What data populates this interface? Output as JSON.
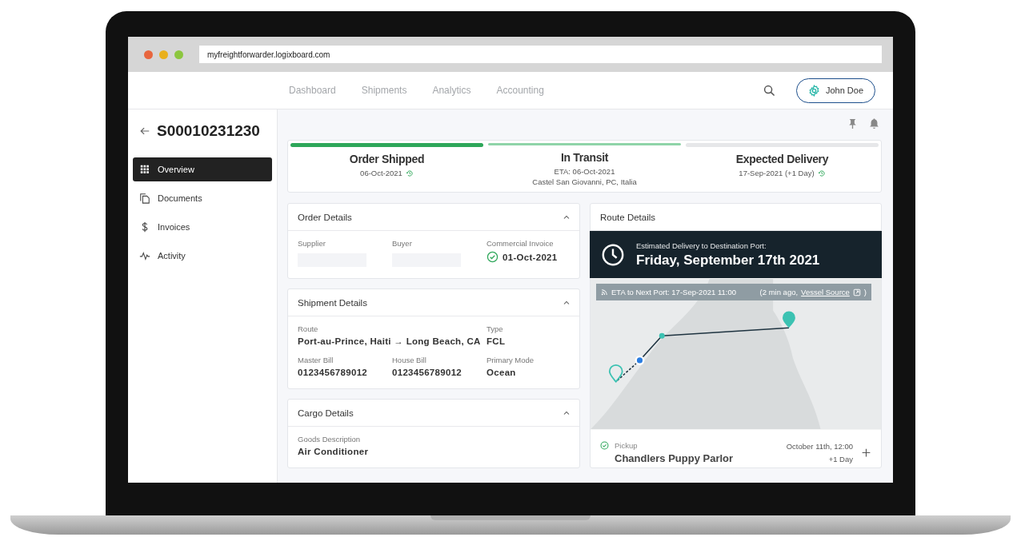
{
  "browser": {
    "url": "myfreightforwarder.logixboard.com"
  },
  "nav": {
    "tabs": [
      "Dashboard",
      "Shipments",
      "Analytics",
      "Accounting"
    ],
    "user": "John Doe"
  },
  "shipment": {
    "id": "S00010231230"
  },
  "sidebar": {
    "items": [
      {
        "label": "Overview",
        "kind": "grid",
        "selected": true
      },
      {
        "label": "Documents",
        "kind": "documents",
        "selected": false
      },
      {
        "label": "Invoices",
        "kind": "dollar",
        "selected": false
      },
      {
        "label": "Activity",
        "kind": "activity",
        "selected": false
      }
    ]
  },
  "stages": [
    {
      "title": "Order Shipped",
      "lines": [
        "06-Oct-2021"
      ],
      "history": true,
      "done": true,
      "current": false
    },
    {
      "title": "In Transit",
      "lines": [
        "ETA: 06-Oct-2021",
        "Castel San Giovanni, PC, Italia"
      ],
      "history": false,
      "done": false,
      "current": true
    },
    {
      "title": "Expected Delivery",
      "lines": [
        "17-Sep-2021 (+1 Day)"
      ],
      "history": true,
      "done": false,
      "current": false
    }
  ],
  "detail_cards": [
    {
      "title": "Order Details",
      "expanded": true,
      "fields": [
        {
          "label": "Supplier",
          "kind": "blank"
        },
        {
          "label": "Buyer",
          "kind": "blank"
        },
        {
          "label": "Commercial Invoice",
          "kind": "done",
          "value": "01-Oct-2021"
        }
      ]
    },
    {
      "title": "Shipment Details",
      "expanded": true,
      "fields": [
        {
          "label": "Route",
          "kind": "wide",
          "value": "Port-au-Prince, Haiti → Long Beach, CA"
        },
        {
          "label": "Type",
          "kind": "text",
          "value": "FCL"
        },
        {
          "label": "Master Bill",
          "kind": "text",
          "value": "0123456789012"
        },
        {
          "label": "House Bill",
          "kind": "text",
          "value": "0123456789012"
        },
        {
          "label": "Primary Mode",
          "kind": "text",
          "value": "Ocean"
        }
      ]
    },
    {
      "title": "Cargo Details",
      "expanded": true,
      "fields": [
        {
          "label": "Goods Description",
          "kind": "text",
          "value": "Air Conditioner"
        }
      ]
    }
  ],
  "route": {
    "title": "Route Details",
    "banner_label": "Estimated Delivery to Destination Port:",
    "banner_date": "Friday, September 17th 2021",
    "eta": "ETA to Next Port: 17-Sep-2021 11:00",
    "eta_age": "(2 min ago,",
    "eta_link": "Vessel Source",
    "eta_end": ")",
    "stops": [
      {
        "done": true,
        "label": "Pickup",
        "place": "Chandlers Puppy Parlor",
        "time": "October 11th, 12:00",
        "offset": "+1 Day"
      }
    ]
  }
}
